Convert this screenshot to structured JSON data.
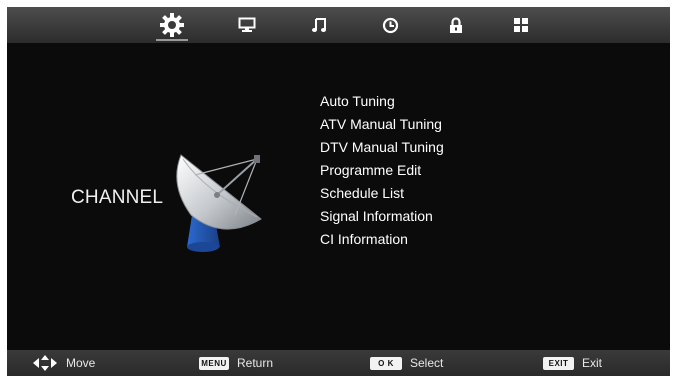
{
  "top_tabs": [
    {
      "icon": "gear-icon",
      "active": true
    },
    {
      "icon": "monitor-icon",
      "active": false
    },
    {
      "icon": "music-note-icon",
      "active": false
    },
    {
      "icon": "clock-icon",
      "active": false
    },
    {
      "icon": "lock-icon",
      "active": false
    },
    {
      "icon": "grid-icon",
      "active": false
    }
  ],
  "section_title": "CHANNEL",
  "menu": {
    "items": [
      "Auto Tuning",
      "ATV Manual Tuning",
      "DTV Manual Tuning",
      "Programme Edit",
      "Schedule List",
      "Signal Information",
      "CI Information"
    ]
  },
  "footer": {
    "move_label": "Move",
    "menu_key": "MENU",
    "return_label": "Return",
    "ok_key": "O K",
    "select_label": "Select",
    "exit_key": "EXIT",
    "exit_label": "Exit"
  },
  "colors": {
    "background": "#0b0b0b",
    "bar": "#3a3a3a",
    "text": "#ffffff",
    "dish_stand": "#2f6fd0"
  }
}
